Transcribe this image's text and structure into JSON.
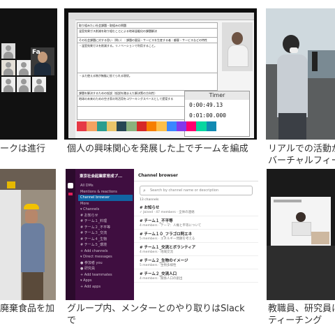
{
  "captions": {
    "c1": "ークは進行",
    "c2": "個人の興味関心を発展した上でチームを編成",
    "c3_line1": "リアルでの活動が",
    "c3_line2": "バーチャルフィー",
    "c4": "廃棄食品を加",
    "c5_line1": "グループ内、メンターとのやり取りはSlack",
    "c5_line2": "で",
    "c6_line1": "教職員、研究員に",
    "c6_line2": "ティーチング"
  },
  "tile1": {
    "screen_text": "Fa"
  },
  "tile2": {
    "doc_rows": [
      "取り組みたい社会課題・取組みの問題",
      "温室効果ガス削減を取り組むことによる地球温暖化の課題解決",
      "その社会課題に対する思い（問い）｜課題の要因・サービスを生産する者｜顧客・サービスなどの特性",
      "・温室効果ガスを削減する。リノベーションで利用すること。",
      "・まだ使える物が無駄に捨てられる現状。",
      "課題を解決するための仮説（仮説を踏まえた解決策の方向性）",
      "地球の未来のための空き家の利活用をコワーキングスペースとして提案する"
    ],
    "timer_title": "Timer",
    "timer_line1": "0:00:49.13",
    "timer_line2": "0:01:00.000",
    "stripe_colors": [
      "#e63946",
      "#f4a261",
      "#2a9d8f",
      "#e9c46a",
      "#264653",
      "#8ab17d",
      "#d62828",
      "#f77f00",
      "#fcbf49",
      "#3a86ff",
      "#8338ec",
      "#ff006e",
      "#06d6a0",
      "#118ab2"
    ]
  },
  "slack": {
    "workspace": "東京社会起業家育成プ...",
    "nav": [
      {
        "label": "All DMs",
        "selected": false
      },
      {
        "label": "Mentions & reactions",
        "selected": false
      },
      {
        "label": "Channel browser",
        "selected": true
      },
      {
        "label": "More",
        "selected": false
      },
      {
        "label": "▾ Channels",
        "selected": false
      },
      {
        "label": "# お知らせ",
        "selected": false
      },
      {
        "label": "# チーム１_料理",
        "selected": false
      },
      {
        "label": "# チーム２_不平等",
        "selected": false
      },
      {
        "label": "# チーム３_交流",
        "selected": false
      },
      {
        "label": "# チーム４_生物",
        "selected": false
      },
      {
        "label": "# チーム５_環境",
        "selected": false
      },
      {
        "label": "+ Add channels",
        "selected": false
      },
      {
        "label": "▾ Direct messages",
        "selected": false
      },
      {
        "label": "● 参加者 you",
        "selected": false
      },
      {
        "label": "● 研究員",
        "selected": false
      },
      {
        "label": "+ Add teammates",
        "selected": false
      },
      {
        "label": "▾ Apps",
        "selected": false
      },
      {
        "label": "+ Add apps",
        "selected": false
      }
    ],
    "header": "Channel browser",
    "search_placeholder": "Search by channel name or description",
    "count": "13 channels",
    "channels": [
      {
        "name": "# お知らせ",
        "desc": "✓ Joined · 47 members · 全体の連絡"
      },
      {
        "name": "# チーム１_不平等",
        "desc": "4 members · テーマ：人権と平等について"
      },
      {
        "name": "# チーム１０_フラゴロ阿エネ",
        "desc": "5 members · エネルギー問題を考える"
      },
      {
        "name": "# チーム１_交流とボランティア",
        "desc": "4 members · 地域交流"
      },
      {
        "name": "# チーム２_生物のイメージ",
        "desc": "5 members · 生物多様性"
      },
      {
        "name": "# チーム２_交流人口",
        "desc": "4 members · 関係人口の創出"
      }
    ]
  }
}
